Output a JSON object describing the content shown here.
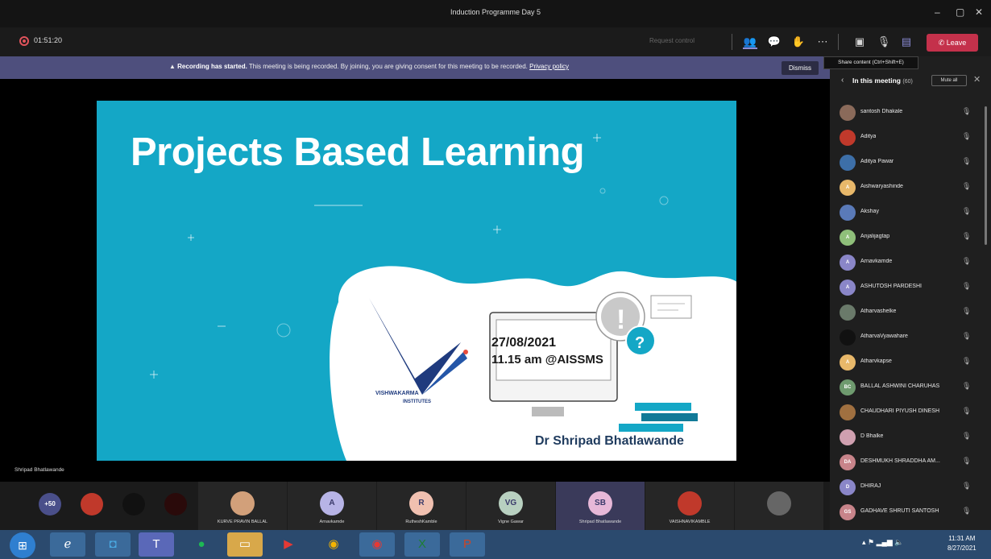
{
  "window": {
    "title": "Induction Programme Day 5",
    "minimize": "–",
    "restore": "▢",
    "close": "✕"
  },
  "toolbar": {
    "timer": "01:51:20",
    "request_control": "Request control",
    "leave_label": "Leave",
    "icons": [
      "people-icon",
      "chat-icon",
      "reactions-icon",
      "more-icon",
      "camera-off-icon",
      "mic-off-icon",
      "share-icon"
    ]
  },
  "banner": {
    "bold": "Recording has started.",
    "message": "This meeting is being recorded. By joining, you are giving consent for this meeting to be recorded.",
    "link": "Privacy policy",
    "dismiss": "Dismiss"
  },
  "tooltip": "Share content (Ctrl+Shift+E)",
  "slide": {
    "title": "Projects Based Learning",
    "date": "27/08/2021",
    "time": "11.15 am @AISSMS",
    "author": "Dr Shripad Bhatlawande",
    "logo_text": "VISHWAKARMA",
    "logo_sub": "INSTITUTES"
  },
  "speaker_name": "Shripad Bhatlawande",
  "panel": {
    "back": "‹",
    "title": "In this meeting",
    "count": "(60)",
    "mute_all": "Mute all",
    "close": "✕",
    "participants": [
      {
        "name": "santosh Dhakale",
        "initials": "",
        "color": "#8a6a5a"
      },
      {
        "name": "Aditya",
        "initials": "",
        "color": "#c0392b"
      },
      {
        "name": "Aditya Pawar",
        "initials": "",
        "color": "#3d6fa8"
      },
      {
        "name": "Aishwaryashinde",
        "initials": "A",
        "color": "#e8b86a"
      },
      {
        "name": "Akshay",
        "initials": "",
        "color": "#5a7ab8"
      },
      {
        "name": "Anjalijagtap",
        "initials": "A",
        "color": "#8fbf7a"
      },
      {
        "name": "Arnavkamde",
        "initials": "A",
        "color": "#8a86c8"
      },
      {
        "name": "ASHUTOSH PARDESHI",
        "initials": "A",
        "color": "#8a86c8"
      },
      {
        "name": "Atharvashelke",
        "initials": "",
        "color": "#6a7a6a"
      },
      {
        "name": "AtharvaVyawahare",
        "initials": "",
        "color": "#111111"
      },
      {
        "name": "Atharvkapse",
        "initials": "A",
        "color": "#e8b86a"
      },
      {
        "name": "BALLAL ASHWINI CHARUHAS",
        "initials": "BC",
        "color": "#6e9a6e"
      },
      {
        "name": "CHAUDHARI PIYUSH DINESH",
        "initials": "",
        "color": "#a07040"
      },
      {
        "name": "D Bhalke",
        "initials": "",
        "color": "#d0a0b0"
      },
      {
        "name": "DESHMUKH SHRADDHA AM...",
        "initials": "DA",
        "color": "#c8848a"
      },
      {
        "name": "DHIRAJ",
        "initials": "D",
        "color": "#8a86c8"
      },
      {
        "name": "GADHAVE SHRUTI SANTOSH",
        "initials": "GS",
        "color": "#c8848a"
      }
    ]
  },
  "gallery": {
    "overflow": "+50",
    "tiles": [
      {
        "label": "KURVE PRAVIN BALLAL",
        "initials": "",
        "color": "#d2a07a"
      },
      {
        "label": "Arnavkamde",
        "initials": "A",
        "color": "#b7b4e6"
      },
      {
        "label": "RutheshKamble",
        "initials": "R",
        "color": "#f0c0b0"
      },
      {
        "label": "Vigne Gawar",
        "initials": "VG",
        "color": "#b8d0c0"
      },
      {
        "label": "Shripad Bhatlawande",
        "initials": "SB",
        "color": "#e7b8d8"
      },
      {
        "label": "VAISHNAVIKAMBLE",
        "initials": "",
        "color": "#c0392b"
      },
      {
        "label": "",
        "initials": "",
        "color": "#666666"
      }
    ]
  },
  "taskbar": {
    "apps": [
      "explorer",
      "ie-icon",
      "outlook-icon",
      "teams-icon",
      "spotify-icon",
      "files-icon",
      "youtube-icon",
      "chrome-icon",
      "chrome2-icon",
      "excel-icon",
      "powerpoint-icon"
    ],
    "time": "11:31 AM",
    "date": "8/27/2021"
  }
}
